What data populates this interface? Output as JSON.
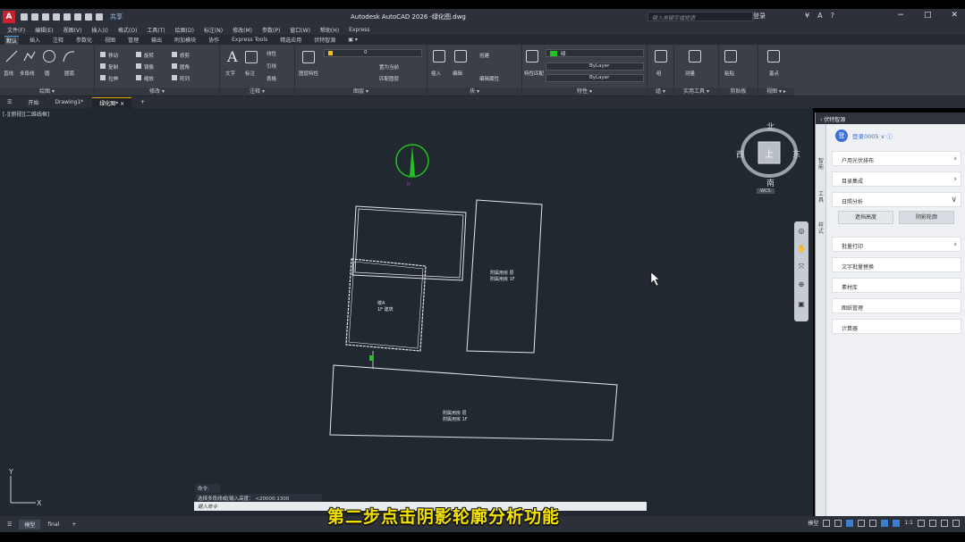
{
  "app": {
    "title": "Autodesk AutoCAD 2026   -绿化图.dwg",
    "logo": "A",
    "share_label": "共享",
    "search_placeholder": "键入关键字或短语",
    "user_label": "登录",
    "window_controls": [
      "−",
      "□",
      "✕"
    ]
  },
  "menu": [
    "文件(F)",
    "编辑(E)",
    "视图(V)",
    "插入(I)",
    "格式(O)",
    "工具(T)",
    "绘图(D)",
    "标注(N)",
    "修改(M)",
    "参数(P)",
    "窗口(W)",
    "帮助(H)",
    "Express"
  ],
  "ribbon_tabs": [
    "默认",
    "插入",
    "注释",
    "参数化",
    "视图",
    "管理",
    "输出",
    "附加模块",
    "协作",
    "Express Tools",
    "精选应用",
    "伏特智源",
    "▣ ▾"
  ],
  "ribbon": {
    "draw": {
      "label": "绘图 ▾",
      "tools": [
        "直线",
        "多段线",
        "圆",
        "圆弧"
      ]
    },
    "modify": {
      "label": "修改 ▾",
      "tools": [
        "移动",
        "旋转",
        "修剪",
        "复制",
        "镜像",
        "圆角",
        "拉伸",
        "缩放",
        "阵列"
      ]
    },
    "annotation": {
      "label": "注释 ▾",
      "tools": [
        "文字",
        "标注",
        "线性",
        "引线",
        "表格"
      ]
    },
    "layers": {
      "label": "图层 ▾",
      "tools": [
        "图层特性",
        "置为当前",
        "匹配图层"
      ],
      "current_layer": "0"
    },
    "block": {
      "label": "块 ▾",
      "tools": [
        "插入",
        "编辑",
        "创建",
        "编辑属性"
      ]
    },
    "properties": {
      "label": "特性 ▾",
      "tools": [
        "特性匹配"
      ],
      "bylayer_1": "ByLayer",
      "bylayer_2": "ByLayer",
      "color_label": "绿"
    },
    "groups": {
      "label": "组 ▾",
      "tools": [
        "组"
      ]
    },
    "utilities": {
      "label": "实用工具 ▾",
      "tools": [
        "测量"
      ]
    },
    "clipboard": {
      "label": "剪贴板",
      "tools": [
        "粘贴"
      ]
    },
    "view": {
      "label": "视图 ▾ ▸",
      "tools": [
        "基点"
      ]
    }
  },
  "doc_tabs": [
    {
      "label": "☰"
    },
    {
      "label": "开始"
    },
    {
      "label": "Drawing1*"
    },
    {
      "label": "绿化图* ×"
    },
    {
      "label": "+"
    }
  ],
  "viewport_label": "[-][俯视][二维线框]",
  "viewcube": {
    "north": "北",
    "south": "南",
    "east": "东",
    "west": "西",
    "top": "上",
    "wcs": "WCS"
  },
  "drawing": {
    "building_a_label": "楼A\n1F 建筑",
    "building_b_label": "附属用房 层\n附属用房 1F",
    "building_c_label": "附属用房 层\n附属用房 1F",
    "compass_label": "N"
  },
  "command": {
    "history": "命令:",
    "line": "选择多段线或[输入高度：  <20000:1300",
    "input_placeholder": "键入命令"
  },
  "subtitle": "第二步点击阴影轮廓分析功能",
  "status": {
    "tabs": [
      "模型",
      "final",
      "+"
    ],
    "model_label": "模型",
    "scale": "1:1"
  },
  "panel": {
    "title": "‹ 伏特智源",
    "vertical_tabs": [
      "智能",
      "工具",
      "样式"
    ],
    "user": {
      "avatar_text": "登",
      "name": "登录0005 ∨ ⓘ"
    },
    "items": [
      {
        "label": "户用光伏排布",
        "chevron": "›"
      },
      {
        "label": "目录集成",
        "chevron": "›"
      },
      {
        "label": "日照分析",
        "chevron": "∨"
      }
    ],
    "sub_buttons": [
      "遮挡高度",
      "阴影轮廓"
    ],
    "items2": [
      {
        "label": "批量打印",
        "chevron": "›"
      },
      {
        "label": "文字批量替换",
        "chevron": ""
      },
      {
        "label": "素材库",
        "chevron": ""
      },
      {
        "label": "图纸管理",
        "chevron": ""
      },
      {
        "label": "计算器",
        "chevron": ""
      }
    ]
  },
  "colors": {
    "accent": "#3b6fd4",
    "subtitle": "#f3e200",
    "compass": "#22c322",
    "canvas": "#212830"
  }
}
